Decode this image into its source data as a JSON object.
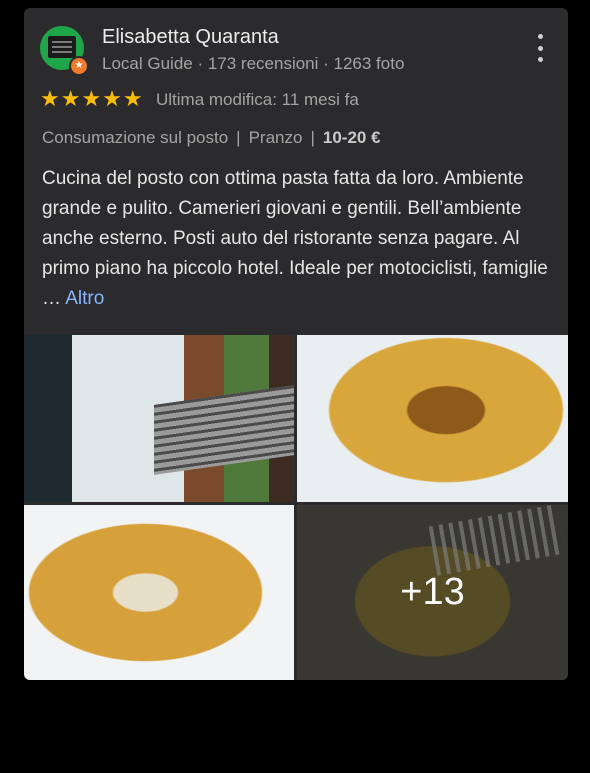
{
  "review": {
    "author": "Elisabetta Quaranta",
    "author_meta": "Local Guide · 173 recensioni · 1263 foto",
    "stars": "★★★★★",
    "edited": "Ultima modifica: 11 mesi fa",
    "attr_service": "Consumazione sul posto",
    "attr_meal": "Pranzo",
    "attr_price": "10-20 €",
    "text": "Cucina del posto con ottima pasta fatta da loro. Ambiente grande e pulito. Camerieri giovani e gentili. Bell’ambiente anche esterno. Posti auto del ristorante senza pagare. Al primo piano ha piccolo hotel. Ideale per motociclisti, famiglie …",
    "more_label": "Altro",
    "rating_value": 5
  },
  "photos": {
    "more_count": "+13"
  },
  "colors": {
    "card_bg": "#2b2b2d",
    "star": "#fbbc04",
    "link": "#8ab4f8",
    "avatar": "#1fa64a"
  }
}
